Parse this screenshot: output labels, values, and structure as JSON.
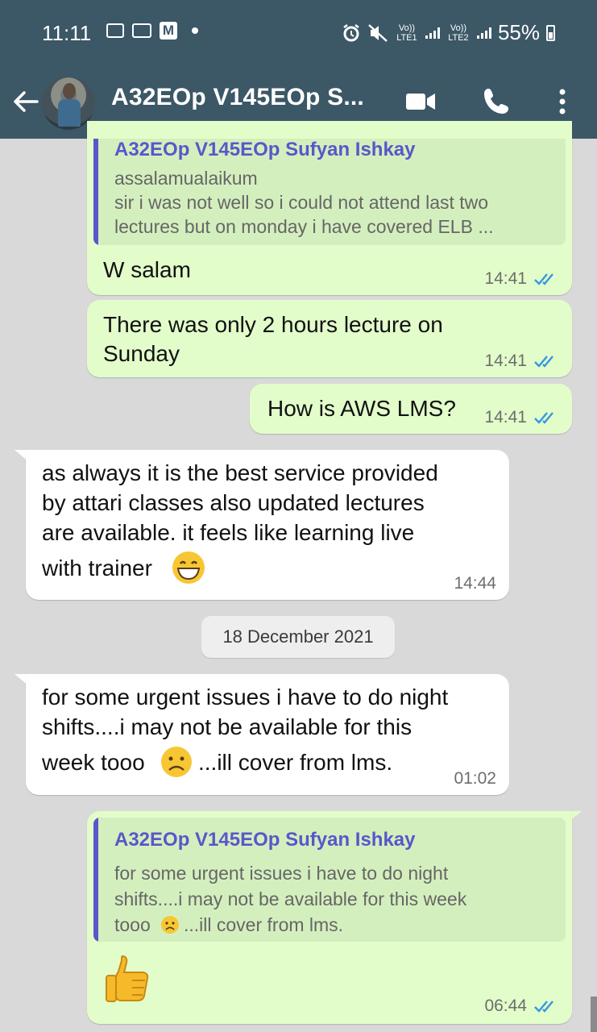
{
  "status_bar": {
    "time": "11:11",
    "battery": "55%",
    "net1": "Vo)) LTE1",
    "net2": "Vo)) LTE2",
    "icons": [
      "gallery-icon",
      "voicemail-icon",
      "m-app-icon",
      "alarm-icon",
      "mute-icon",
      "signal-icon",
      "battery-icon"
    ]
  },
  "header": {
    "title": "A32EOp V145EOp S...",
    "icons": [
      "back-arrow-icon",
      "video-call-icon",
      "phone-icon",
      "more-vert-icon"
    ]
  },
  "colors": {
    "header_bg": "#3c5766",
    "chat_bg": "#d9d9d9",
    "outgoing_bubble": "#e2fdca",
    "incoming_bubble": "#ffffff",
    "quote_accent": "#5b56c9",
    "read_tick": "#3597e0"
  },
  "messages": [
    {
      "direction": "out",
      "quote": {
        "author": "A32EOp V145EOp Sufyan Ishkay",
        "lines": [
          "assalamualaikum",
          "sir i was not well so i could not attend last two",
          "lectures but on monday i have covered ELB ..."
        ]
      },
      "text": "W salam",
      "time": "14:41"
    },
    {
      "direction": "out",
      "lines": [
        "There was only 2 hours lecture on",
        "Sunday"
      ],
      "time": "14:41"
    },
    {
      "direction": "out",
      "text": "How is AWS LMS?",
      "time": "14:41"
    },
    {
      "direction": "in",
      "lines": [
        "as always it is the best service provided",
        "by attari classes also updated lectures",
        "are available. it feels like learning live",
        "with trainer"
      ],
      "emoji": "grinning-face-emoji",
      "time": "14:44"
    },
    {
      "direction": "in",
      "lines": [
        "for some urgent issues i have to do night",
        "shifts....i may not be available for this",
        "week tooo",
        "...ill cover from lms."
      ],
      "emoji": "frowning-face-emoji",
      "time": "01:02"
    },
    {
      "direction": "out",
      "quote": {
        "author": "A32EOp V145EOp Sufyan Ishkay",
        "lines": [
          "for some urgent issues i have to do night",
          "shifts....i may not be available for this week",
          "tooo",
          "...ill cover from lms."
        ]
      },
      "emoji": "thumbs-up-emoji",
      "time": "06:44"
    }
  ],
  "date_separator": "18 December 2021"
}
